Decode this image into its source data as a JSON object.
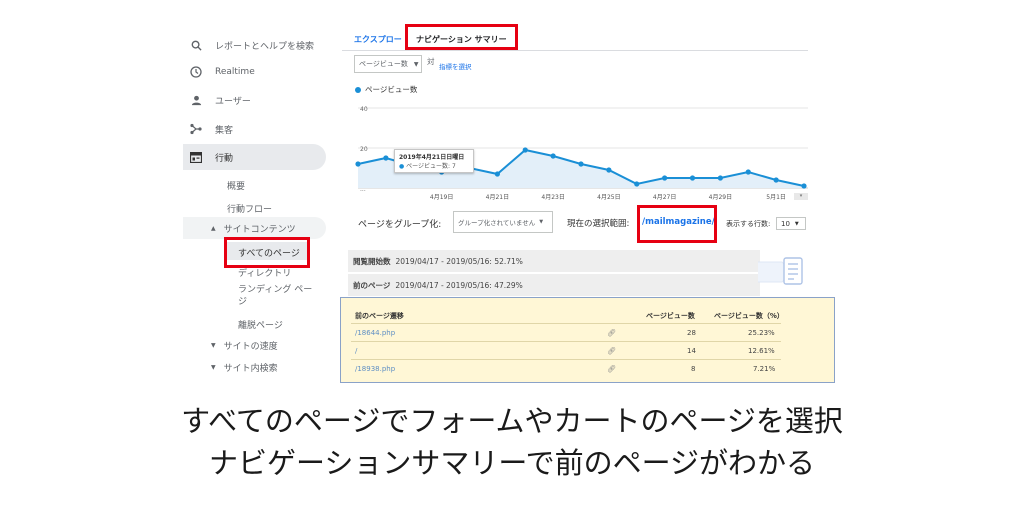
{
  "sidebar": {
    "search_label": "レポートとヘルプを検索",
    "realtime": "Realtime",
    "user": "ユーザー",
    "acquisition": "集客",
    "behavior": "行動",
    "overview": "概要",
    "flow": "行動フロー",
    "site_content": "サイトコンテンツ",
    "all_pages": "すべてのページ",
    "directory": "ディレクトリ",
    "landing_pages": "ランディング ペー\nジ",
    "exit_pages": "離脱ページ",
    "site_speed": "サイトの速度",
    "site_search": "サイト内検索"
  },
  "tabs": {
    "explorer": "エクスプロー",
    "nav_summary": "ナビゲーション サマリー"
  },
  "controls": {
    "metric_dropdown": "ページビュー数",
    "vs": "対",
    "select_metric": "指標を選択",
    "legend": "ページビュー数",
    "group_label": "ページをグループ化:",
    "group_value": "グループ化されていません",
    "current_selection_label": "現在の選択範囲:",
    "current_selection_value": "/mailmagazine/",
    "rows_label": "表示する行数:",
    "rows_value": "10"
  },
  "tooltip": {
    "date": "2019年4月21日日曜日",
    "metric": "ページビュー数: 7"
  },
  "chart_data": {
    "type": "line",
    "x": [
      "",
      "",
      "",
      "4月19日",
      "",
      "4月21日",
      "",
      "4月23日",
      "",
      "4月25日",
      "",
      "4月27日",
      "",
      "4月29日",
      "",
      "5月1日",
      ""
    ],
    "series": [
      {
        "name": "ページビュー数",
        "values": [
          12,
          15,
          11,
          8,
          10,
          7,
          19,
          16,
          12,
          9,
          2,
          5,
          5,
          5,
          8,
          4,
          1
        ]
      }
    ],
    "y_ticks": [
      "40",
      "20",
      "..."
    ],
    "ylim": [
      0,
      40
    ],
    "color": "#1a8fd6"
  },
  "bars": {
    "first_label": "閲覧開始数",
    "first_value": "2019/04/17 - 2019/05/16: 52.71%",
    "prev_label": "前のページ",
    "prev_value": "2019/04/17 - 2019/05/16: 47.29%"
  },
  "table": {
    "headers": [
      "前のページ遷移",
      "ページビュー数",
      "ページビュー数（%）"
    ],
    "rows": [
      [
        "/18644.php",
        "28",
        "25.23%"
      ],
      [
        "/",
        "14",
        "12.61%"
      ],
      [
        "/18938.php",
        "8",
        "7.21%"
      ]
    ]
  },
  "caption": {
    "line1": "すべてのページでフォームやカートのページを選択",
    "line2": "ナビゲーションサマリーで前のページがわかる"
  },
  "colors": {
    "highlight_red": "#e60012",
    "accent": "#1a73e8",
    "table_bg": "#fff7d6"
  }
}
